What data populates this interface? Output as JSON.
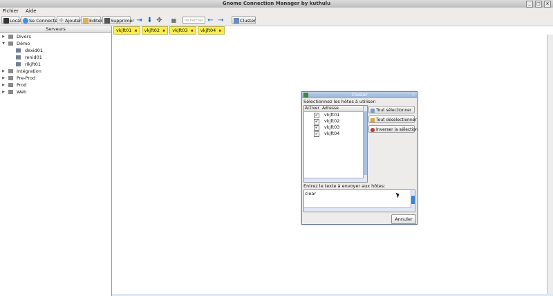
{
  "window": {
    "title": "Gnome Connection Manager by kuthulu"
  },
  "menu": [
    "Fichier",
    "Aide"
  ],
  "toolbar": {
    "local": "Local",
    "connect": "Se Connecter",
    "add": "Ajouter",
    "edit": "Editer",
    "delete": "Supprimer",
    "search_placeholder": "rechercher",
    "cluster": "Cluster"
  },
  "sidebar": {
    "header": "Serveurs",
    "items": [
      {
        "label": "Divers",
        "level": 0,
        "type": "folder",
        "expanded": false
      },
      {
        "label": "Démo",
        "level": 0,
        "type": "folder",
        "expanded": true
      },
      {
        "label": "dexid01",
        "level": 1,
        "type": "host"
      },
      {
        "label": "renid01",
        "level": 1,
        "type": "host"
      },
      {
        "label": "rlkjft01",
        "level": 1,
        "type": "host"
      },
      {
        "label": "Intégration",
        "level": 0,
        "type": "folder",
        "expanded": false
      },
      {
        "label": "Pre-Prod",
        "level": 0,
        "type": "folder",
        "expanded": false
      },
      {
        "label": "Prod",
        "level": 0,
        "type": "folder",
        "expanded": false
      },
      {
        "label": "Web",
        "level": 0,
        "type": "folder",
        "expanded": false
      }
    ]
  },
  "tabs": [
    {
      "label": "vkjft01"
    },
    {
      "label": "vkjft02"
    },
    {
      "label": "vkjft03"
    },
    {
      "label": "vkjft04"
    }
  ],
  "cluster_dialog": {
    "title": "Cluster",
    "select_label": "Sélectionnez les hôtes à utiliser:",
    "col_activate": "Activer",
    "col_address": "Adresse",
    "hosts": [
      {
        "address": "vkjft01",
        "checked": true
      },
      {
        "address": "vkjft02",
        "checked": true
      },
      {
        "address": "vkjft03",
        "checked": true
      },
      {
        "address": "vkjft04",
        "checked": true
      }
    ],
    "btn_select_all": "Tout sélectionner",
    "btn_deselect_all": "Tout désélectionner",
    "btn_invert": "Inverser la sélection",
    "text_label": "Entrez le texte à envoyer aux hôtes:",
    "text_value": "clear",
    "btn_cancel": "Annuler"
  },
  "colors": {
    "tab_bg": "#f6ee4c",
    "dialog_title": "#95b1d6",
    "accent": "#1f5fb5"
  }
}
